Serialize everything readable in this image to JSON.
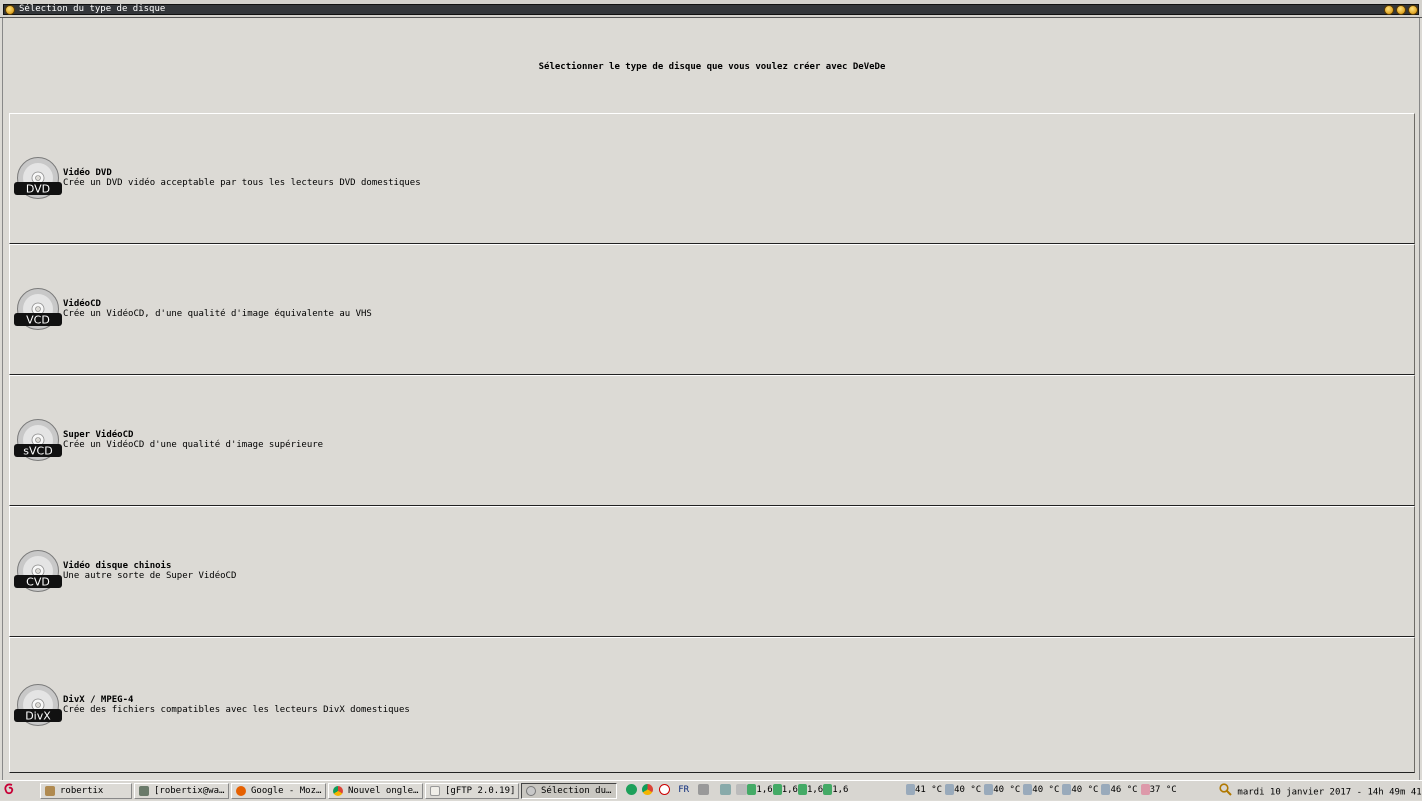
{
  "window": {
    "title": "Sélection du type de disque",
    "heading": "Sélectionner le type de disque que vous voulez créer avec DeVeDe"
  },
  "options": [
    {
      "label": "DVD",
      "title": "Vidéo DVD",
      "description": "Crée un DVD vidéo acceptable par tous les lecteurs DVD domestiques"
    },
    {
      "label": "VCD",
      "title": "VidéoCD",
      "description": "Crée un VidéoCD, d'une qualité d'image équivalente au VHS"
    },
    {
      "label": "sVCD",
      "title": "Super VidéoCD",
      "description": "Crée un VidéoCD d'une qualité d'image supérieure"
    },
    {
      "label": "CVD",
      "title": "Vidéo disque chinois",
      "description": "Une autre sorte de Super VidéoCD"
    },
    {
      "label": "DivX",
      "title": "DivX / MPEG-4",
      "description": "Crée des fichiers compatibles avec les lecteurs DivX domestiques"
    }
  ],
  "taskbar": {
    "tasks": [
      {
        "label": "robertix",
        "icon": "folder-icon"
      },
      {
        "label": "[robertix@wa…",
        "icon": "terminal-icon"
      },
      {
        "label": "Google - Moz…",
        "icon": "firefox-icon"
      },
      {
        "label": "Nouvel ongle…",
        "icon": "chrome-icon"
      },
      {
        "label": "[gFTP 2.0.19]",
        "icon": "gftp-icon"
      },
      {
        "label": "Sélection du…",
        "icon": "devede-icon"
      }
    ],
    "keyboard_layout": "FR",
    "cpu_readouts": [
      "1,6",
      "1,6",
      "1,6",
      "1,6"
    ],
    "temperatures": [
      "41 °C",
      "40 °C",
      "40 °C",
      "40 °C",
      "40 °C",
      "46 °C",
      "37 °C"
    ],
    "clock": "mardi 10 janvier 2017 - 14h 49m 41s"
  },
  "colors": {
    "background": "#dcdad5",
    "titlebar": "#33363a",
    "window_buttons": "#e8a800"
  }
}
